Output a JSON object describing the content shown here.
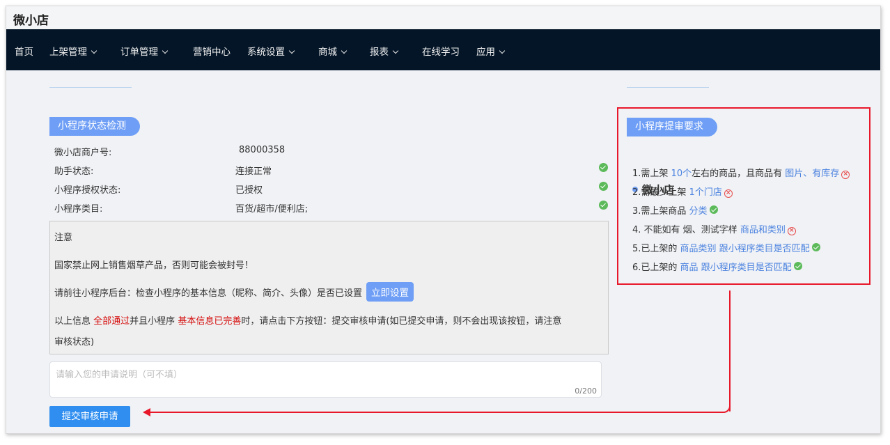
{
  "app_title": "微小店",
  "nav": {
    "items": [
      {
        "label": "首页",
        "dropdown": false
      },
      {
        "label": "上架管理",
        "dropdown": true
      },
      {
        "label": "订单管理",
        "dropdown": true
      },
      {
        "label": "营销中心",
        "dropdown": false
      },
      {
        "label": "系统设置",
        "dropdown": true
      },
      {
        "label": "商城",
        "dropdown": true
      },
      {
        "label": "报表",
        "dropdown": true
      },
      {
        "label": "在线学习",
        "dropdown": false
      },
      {
        "label": "应用",
        "dropdown": true
      }
    ]
  },
  "status_check": {
    "title": "小程序状态检测",
    "rows": [
      {
        "label": "微小店商户号:",
        "value": "88000358",
        "ok": false
      },
      {
        "label": "助手状态:",
        "value": "连接正常",
        "ok": true
      },
      {
        "label": "小程序授权状态:",
        "value": "已授权",
        "ok": true
      },
      {
        "label": "小程序类目:",
        "value": "百货/超市/便利店;",
        "ok": true
      }
    ]
  },
  "notice": {
    "heading": "注意",
    "warning": "国家禁止网上销售烟草产品，否则可能会被封号！",
    "check_text": "请前往小程序后台：检查小程序的基本信息（昵称、简介、头像）是否已设置",
    "set_button": "立即设置",
    "info_pre": "以上信息",
    "info_red1": "全部通过",
    "info_mid": "并且小程序",
    "info_red2": "基本信息已完善",
    "info_post": "时，请点击下方按钮：提交审核申请(如已提交申请，则不会出现该按钮，请注意",
    "info_line2": "审核状态)"
  },
  "application": {
    "placeholder": "请输入您的申请说明（可不填）",
    "counter": "0/200",
    "submit_label": "提交审核申请"
  },
  "requirements": {
    "title": "小程序提审要求",
    "shop_name": "微小店",
    "items": [
      {
        "parts": [
          {
            "t": "1.需上架 ",
            "c": "n"
          },
          {
            "t": "10个",
            "c": "b"
          },
          {
            "t": "左右的商品，且商品有 ",
            "c": "n"
          },
          {
            "t": "图片、有库存",
            "c": "b"
          }
        ],
        "status": "fail"
      },
      {
        "parts": [
          {
            "t": "2.需最少上架 ",
            "c": "n"
          },
          {
            "t": "1个门店",
            "c": "b"
          }
        ],
        "status": "fail"
      },
      {
        "parts": [
          {
            "t": "3.需上架商品 ",
            "c": "n"
          },
          {
            "t": "分类",
            "c": "b"
          }
        ],
        "status": "ok"
      },
      {
        "parts": [
          {
            "t": "4. 不能如有 烟、测试字样 ",
            "c": "n"
          },
          {
            "t": "商品和类别",
            "c": "b"
          }
        ],
        "status": "fail"
      },
      {
        "parts": [
          {
            "t": "5.已上架的 ",
            "c": "n"
          },
          {
            "t": "商品类别 跟小程序类目是否匹配",
            "c": "b"
          }
        ],
        "status": "ok"
      },
      {
        "parts": [
          {
            "t": "6.已上架的 ",
            "c": "n"
          },
          {
            "t": "商品 跟小程序类目是否匹配",
            "c": "b"
          }
        ],
        "status": "ok"
      }
    ]
  },
  "colors": {
    "nav_bg": "#041527",
    "accent": "#6e9ef5",
    "submit": "#2f8ef0",
    "highlight": "#e8182a"
  }
}
